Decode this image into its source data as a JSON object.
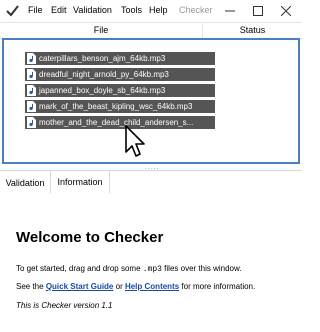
{
  "app": {
    "title": "Checker",
    "menu": [
      "File",
      "Edit",
      "Validation",
      "Tools",
      "Help"
    ]
  },
  "window_controls": {
    "minimize_icon": "minimize-icon",
    "maximize_icon": "maximize-icon",
    "close_icon": "close-icon"
  },
  "table": {
    "columns": [
      "File",
      "Status"
    ],
    "files": [
      "caterpillars_benson_ajm_64kb.mp3",
      "dreadful_night_arnold_py_64kb.mp3",
      "japanned_box_doyle_sb_64kb.mp3",
      "mark_of_the_beast_kipling_wsc_64kb.mp3",
      "mother_and_the_dead_child_andersen_s..."
    ]
  },
  "splitter": {
    "grip": "....."
  },
  "tabs": [
    "Validation",
    "Information"
  ],
  "welcome": {
    "heading": "Welcome to Checker",
    "p1_before": "To get started, drag and drop some ",
    "p1_code": ".mp3",
    "p1_after": " files over this window.",
    "p2_before": "See the ",
    "p2_link1": "Quick Start Guide",
    "p2_mid": " or ",
    "p2_link2": "Help Contents",
    "p2_after": " for more information.",
    "version": "This is Checker version 1.1"
  },
  "colors": {
    "accent": "#4a7fc1",
    "file_item_bg": "#555555",
    "link": "#1a4aa8"
  }
}
